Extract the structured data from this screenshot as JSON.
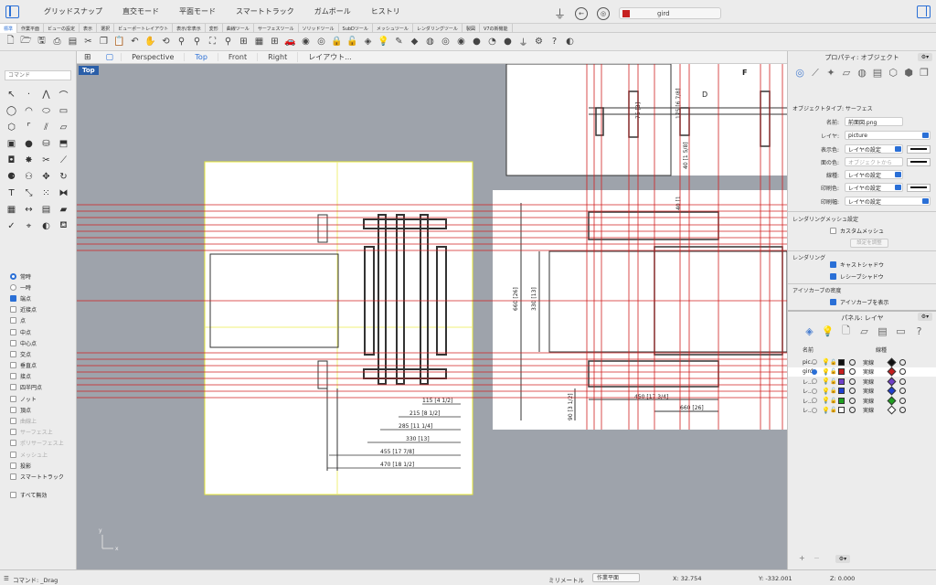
{
  "titlebar": {
    "modes": [
      "グリッドスナップ",
      "直交モード",
      "平面モード",
      "スマートトラック",
      "ガムボール",
      "ヒストリ"
    ],
    "layer_name": "gird",
    "layer_color": "#c62020"
  },
  "tabs": [
    "標準",
    "作業平面",
    "ビューの設定",
    "表示",
    "選択",
    "ビューポートレイアウト",
    "表示/非表示",
    "変形",
    "曲線ツール",
    "サーフェスツール",
    "ソリッドツール",
    "SubDツール",
    "メッシュツール",
    "レンダリングツール",
    "製図",
    "V7の新機能"
  ],
  "command": {
    "placeholder": "コマンド"
  },
  "osnap": {
    "items": [
      {
        "label": "常時",
        "type": "radio",
        "on": true,
        "dim": false
      },
      {
        "label": "一時",
        "type": "radio",
        "on": false,
        "dim": false
      },
      {
        "label": "端点",
        "type": "check",
        "on": true,
        "dim": false
      },
      {
        "label": "近接点",
        "type": "check",
        "on": false,
        "dim": false
      },
      {
        "label": "点",
        "type": "check",
        "on": false,
        "dim": false
      },
      {
        "label": "中点",
        "type": "check",
        "on": false,
        "dim": false
      },
      {
        "label": "中心点",
        "type": "check",
        "on": false,
        "dim": false
      },
      {
        "label": "交点",
        "type": "check",
        "on": false,
        "dim": false
      },
      {
        "label": "垂直点",
        "type": "check",
        "on": false,
        "dim": false
      },
      {
        "label": "接点",
        "type": "check",
        "on": false,
        "dim": false
      },
      {
        "label": "四半円点",
        "type": "check",
        "on": false,
        "dim": false
      },
      {
        "label": "ノット",
        "type": "check",
        "on": false,
        "dim": false
      },
      {
        "label": "頂点",
        "type": "check",
        "on": false,
        "dim": false
      },
      {
        "label": "曲線上",
        "type": "check",
        "on": false,
        "dim": true
      },
      {
        "label": "サーフェス上",
        "type": "check",
        "on": false,
        "dim": true
      },
      {
        "label": "ポリサーフェス上",
        "type": "check",
        "on": false,
        "dim": true
      },
      {
        "label": "メッシュ上",
        "type": "check",
        "on": false,
        "dim": true
      },
      {
        "label": "投影",
        "type": "check",
        "on": false,
        "dim": false
      },
      {
        "label": "スマートトラック",
        "type": "check",
        "on": false,
        "dim": false
      }
    ],
    "disable_all": "すべて無効"
  },
  "viewtabs": [
    "Perspective",
    "Top",
    "Front",
    "Right",
    "レイアウト..."
  ],
  "viewport": {
    "label": "Top",
    "dims": [
      "115 [4 1/2]",
      "215 [8 1/2]",
      "285 [11 1/4]",
      "330 [13]",
      "455 [17 7/8]",
      "470 [18 1/2]",
      "660 [26]",
      "330 [13]",
      "450 [17 3/4]",
      "660 [26]",
      "90 [3 1/2]",
      "75 [3]",
      "175 [6 7/8]",
      "40 [1 5/8]",
      "40 [1"
    ],
    "letters": [
      "F",
      "D"
    ],
    "axis_x": "x",
    "axis_y": "y"
  },
  "properties": {
    "title": "プロパティ: オブジェクト",
    "object_type": "オブジェクトタイプ: サーフェス",
    "name_label": "名前:",
    "name_value": "前面図.png",
    "layer_label": "レイヤ:",
    "layer_value": "picture",
    "display_color_label": "表示色:",
    "display_color_value": "レイヤの設定",
    "iso_color_label": "面の色:",
    "iso_color_value": "オブジェクトから",
    "linetype_label": "線種:",
    "linetype_value": "レイヤの設定",
    "print_color_label": "印刷色:",
    "print_color_value": "レイヤの設定",
    "print_width_label": "印刷幅:",
    "print_width_value": "レイヤの設定",
    "render_mesh_heading": "レンダリングメッシュ設定",
    "custom_mesh": "カスタムメッシュ",
    "adjust_mesh": "設定を調整",
    "rendering_heading": "レンダリング",
    "cast_shadows": "キャストシャドウ",
    "receive_shadows": "レシーブシャドウ",
    "isocurve_heading": "アイソカーブの密度",
    "show_isocurves": "アイソカーブを表示"
  },
  "layers": {
    "title": "パネル: レイヤ",
    "col_name": "名前",
    "col_linetype": "線種",
    "rows": [
      {
        "name": "pic...",
        "color": "#111111",
        "linetype": "実線",
        "print": "#111111",
        "current": false
      },
      {
        "name": "gird",
        "color": "#c62020",
        "linetype": "実線",
        "print": "#c62020",
        "current": true
      },
      {
        "name": "レ...",
        "color": "#7040c8",
        "linetype": "実線",
        "print": "#7040c8",
        "current": false
      },
      {
        "name": "レ...",
        "color": "#2040d0",
        "linetype": "実線",
        "print": "#2040d0",
        "current": false
      },
      {
        "name": "レ...",
        "color": "#20a020",
        "linetype": "実線",
        "print": "#20a020",
        "current": false
      },
      {
        "name": "レ...",
        "color": "#ffffff",
        "linetype": "実線",
        "print": "#ffffff",
        "current": false
      }
    ]
  },
  "status": {
    "command": "コマンド: _Drag",
    "units": "ミリメートル",
    "cplane": "作業平面",
    "x": "X: 32.754",
    "y": "Y: -332.001",
    "z": "Z: 0.000"
  }
}
